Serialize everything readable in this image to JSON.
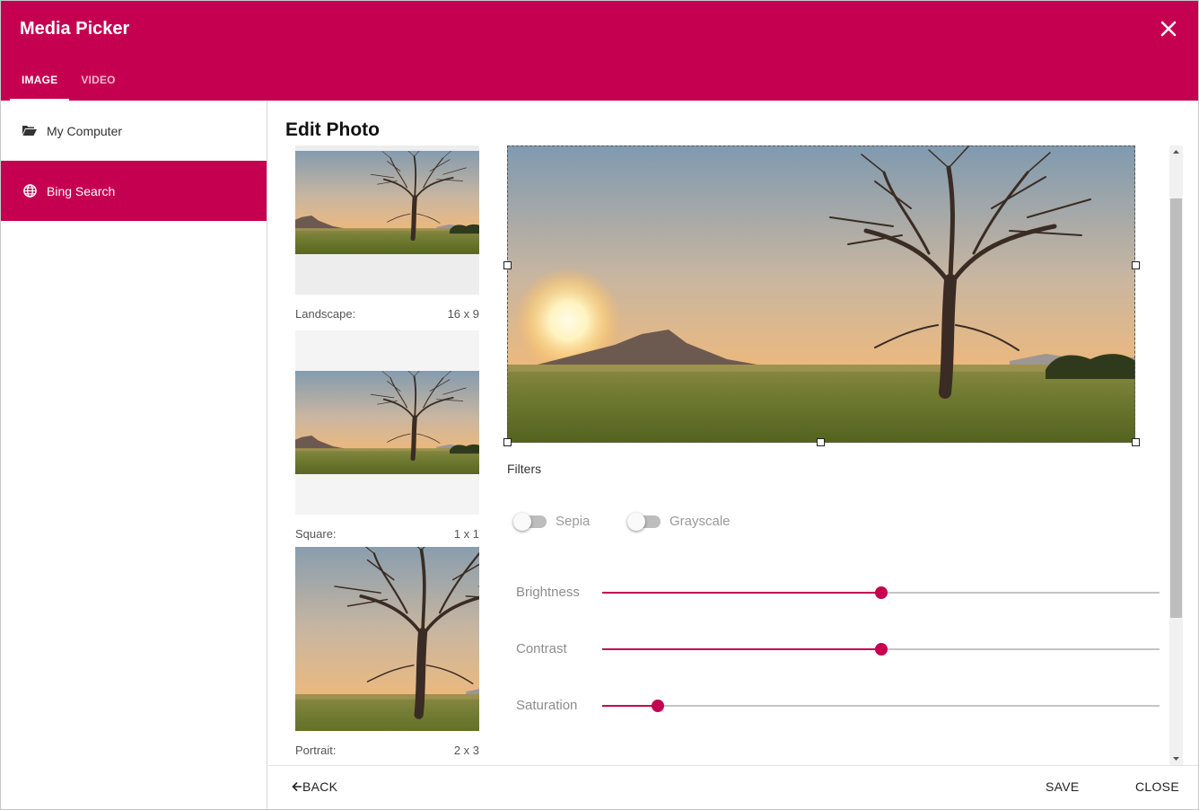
{
  "header": {
    "title": "Media Picker",
    "close_icon": "close-icon",
    "background": "#c50051"
  },
  "tabs": [
    {
      "label": "IMAGE",
      "active": true
    },
    {
      "label": "VIDEO",
      "active": false
    }
  ],
  "sidebar": {
    "items": [
      {
        "label": "My Computer",
        "icon": "folder-open-icon",
        "active": false
      },
      {
        "label": "Bing Search",
        "icon": "globe-icon",
        "active": true
      }
    ]
  },
  "main": {
    "title": "Edit Photo",
    "thumbnails": [
      {
        "name": "Landscape:",
        "ratio": "16 x 9"
      },
      {
        "name": "Square:",
        "ratio": "1 x 1"
      },
      {
        "name": "Portrait:",
        "ratio": "2 x 3"
      }
    ],
    "filters": {
      "title": "Filters",
      "toggles": [
        {
          "label": "Sepia",
          "on": false
        },
        {
          "label": "Grayscale",
          "on": false
        }
      ],
      "sliders": [
        {
          "label": "Brightness",
          "value_fraction": 0.5
        },
        {
          "label": "Contrast",
          "value_fraction": 0.5
        },
        {
          "label": "Saturation",
          "value_fraction": 0.1
        }
      ]
    }
  },
  "footer": {
    "back_label": "BACK",
    "save_label": "SAVE",
    "close_label": "CLOSE"
  },
  "colors": {
    "accent": "#c50051",
    "slider_rail": "#c4c4c4",
    "toggle_off": "#bdbdbd"
  }
}
